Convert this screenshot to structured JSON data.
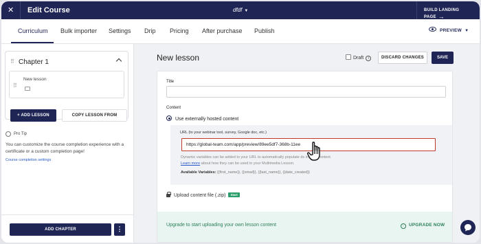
{
  "topbar": {
    "close_icon": "close-icon",
    "title": "Edit Course",
    "course_name": "dfdf",
    "build_landing": "BUILD LANDING PAGE"
  },
  "tabs": [
    {
      "label": "Curriculum",
      "active": true
    },
    {
      "label": "Bulk importer"
    },
    {
      "label": "Settings"
    },
    {
      "label": "Drip"
    },
    {
      "label": "Pricing"
    },
    {
      "label": "After purchase"
    },
    {
      "label": "Publish"
    }
  ],
  "preview": {
    "label": "PREVIEW"
  },
  "sidebar": {
    "chapter_title": "Chapter 1",
    "lesson_name": "New lesson",
    "add_lesson": "+ ADD LESSON",
    "copy_lesson": "COPY LESSON FROM",
    "protip_label": "Pro Tip",
    "protip_text": "You can customize the course completion experience with a certificate or a custom completion page!",
    "protip_link": "Course completion settings",
    "add_chapter": "ADD CHAPTER",
    "more": "⋮"
  },
  "main": {
    "heading": "New lesson",
    "draft_label": "Draft",
    "discard": "DISCARD CHANGES",
    "save": "SAVE",
    "title_label": "Title",
    "title_value": "",
    "content_label": "Content",
    "radio_label": "Use externally hosted content",
    "url_label": "URL (to your webinar tool, survey, Google doc, etc.)",
    "url_value": "https://global-team.com/app/preview/89ee5df7-368b-11ee",
    "dynamic_text": "Dynamic variables can be added to your URL to automatically populate                                ds in your content.",
    "learn_more_link": "Learn more",
    "learn_more_rest": " about how they can be used in your Multimedia Lesson.",
    "avail_label": "Available Variables:",
    "avail_vars": " {{first_name}}, {{email}}, {{last_name}}, {{date_created}}",
    "upload_label": "Upload content file (.zip)",
    "upload_badge": "Start",
    "upgrade_text": "Upgrade to start uploading your own lesson content",
    "upgrade_now": "UPGRADE NOW"
  },
  "colors": {
    "navy": "#1f2555",
    "green": "#2a7f5a",
    "url_border": "#c0392b"
  }
}
